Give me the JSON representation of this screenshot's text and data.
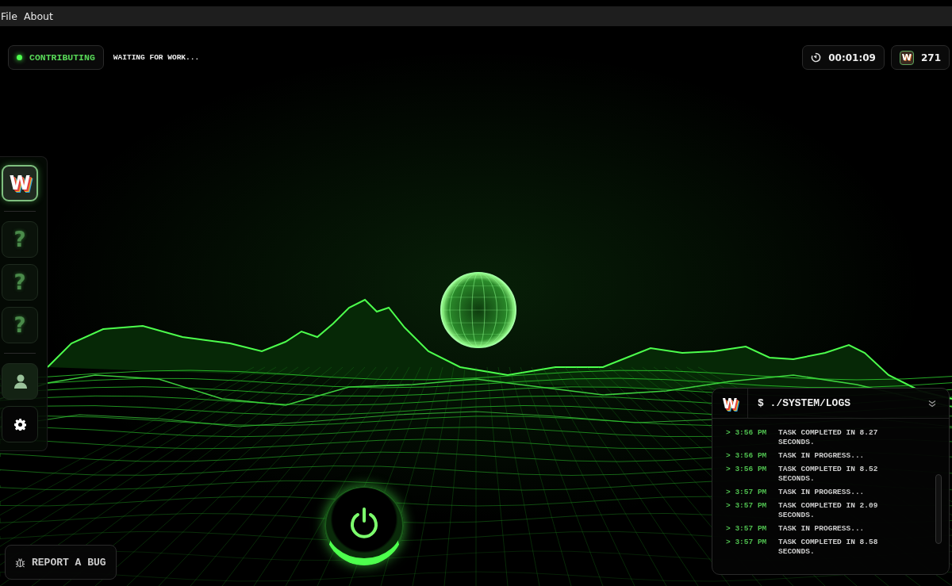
{
  "menu": [
    {
      "label": "File"
    },
    {
      "label": "About"
    }
  ],
  "status": {
    "label": "CONTRIBUTING",
    "active": true,
    "message": "WAITING FOR WORK..."
  },
  "timer": {
    "value": "00:01:09"
  },
  "points": {
    "logo": "W",
    "value": "271"
  },
  "sidebar": {
    "items": [
      {
        "kind": "logo",
        "text": "W",
        "selected": true
      },
      {
        "kind": "locked",
        "text": "?",
        "selected": false
      },
      {
        "kind": "locked",
        "text": "?",
        "selected": false
      },
      {
        "kind": "locked",
        "text": "?",
        "selected": false
      },
      {
        "kind": "profile",
        "selected": false
      },
      {
        "kind": "settings",
        "selected": false
      }
    ]
  },
  "logs": {
    "logo": "W",
    "title": "$ ./SYSTEM/LOGS",
    "entries": [
      {
        "time": "> 3:56 PM",
        "text": "TASK COMPLETED IN 8.27 SECONDS."
      },
      {
        "time": "> 3:56 PM",
        "text": "TASK IN PROGRESS..."
      },
      {
        "time": "> 3:56 PM",
        "text": "TASK COMPLETED IN 8.52 SECONDS."
      },
      {
        "time": "> 3:57 PM",
        "text": "TASK IN PROGRESS..."
      },
      {
        "time": "> 3:57 PM",
        "text": "TASK COMPLETED IN 2.09 SECONDS."
      },
      {
        "time": "> 3:57 PM",
        "text": "TASK IN PROGRESS..."
      },
      {
        "time": "> 3:57 PM",
        "text": "TASK COMPLETED IN 8.58 SECONDS."
      }
    ]
  },
  "power": {
    "on": true
  },
  "report_button": {
    "label": "REPORT A BUG"
  }
}
